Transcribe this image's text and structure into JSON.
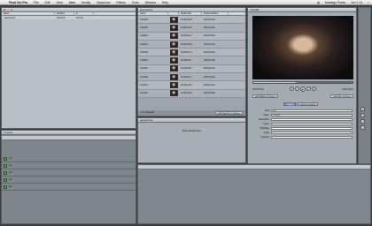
{
  "menubar": {
    "app": "Final Cut Pro",
    "items": [
      "File",
      "Edit",
      "View",
      "Mark",
      "Modify",
      "Sequence",
      "Effects",
      "Tools",
      "Window",
      "Help"
    ],
    "user": "Santiago Prada",
    "clock": "Jun 2 12"
  },
  "browser": {
    "title": "Browser",
    "headers": [
      "Name",
      "Duration",
      "In"
    ],
    "items": [
      {
        "name": "appleshrine",
        "duration": "00:00:12",
        "in": "Not Set"
      }
    ]
  },
  "bin": {
    "title": "appleshrine",
    "headers": [
      "Name",
      "Media Start",
      "Media Duration"
    ],
    "rows": [
      {
        "name": "CO0028",
        "start": "01:08:36:08",
        "dur": "00:00:04:12"
      },
      {
        "name": "CO0030",
        "start": "01:08:40:20",
        "dur": "00:00:03:21"
      },
      {
        "name": "CO0036",
        "start": "01:08:44:17",
        "dur": "00:00:05:02"
      },
      {
        "name": "CO0042",
        "start": "01:08:49:19",
        "dur": "00:00:02:18"
      },
      {
        "name": "CO0048",
        "start": "01:08:52:13",
        "dur": "00:00:06:04"
      },
      {
        "name": "CO0054",
        "start": "01:08:58:17",
        "dur": "00:00:04:09"
      },
      {
        "name": "CO1091",
        "start": "01:09:03:02",
        "dur": "00:00:03:15"
      },
      {
        "name": "CO1096",
        "start": "01:09:06:17",
        "dur": "00:00:05:22"
      },
      {
        "name": "CO1103",
        "start": "01:09:12:15",
        "dur": "00:00:04:01"
      },
      {
        "name": "CO1109",
        "start": "01:09:16:16",
        "dur": "00:00:03:08"
      }
    ],
    "status": "1 of 1 selected",
    "add_button": "Add Selection to Queue"
  },
  "queue": {
    "title": "appleshrine",
    "drop_label": "Drop Media Here"
  },
  "viewer": {
    "title": "CO1109",
    "timecode_left": "00:00:00:00",
    "timecode_right": "00:00:05:22",
    "button_left": "Add Marker to Queue",
    "button_right": "Add Clip to Queue",
    "tabs": [
      "Logging",
      "Capture Settings"
    ],
    "fields": [
      {
        "label": "Reel",
        "value": "001"
      },
      {
        "label": "Name",
        "value": "CO1109"
      },
      {
        "label": "Description",
        "value": ""
      },
      {
        "label": "Scene",
        "value": ""
      },
      {
        "label": "Shot/Take",
        "value": ""
      },
      {
        "label": "Angle",
        "value": ""
      },
      {
        "label": "Log Note",
        "value": ""
      }
    ]
  },
  "timeline": {
    "title": "Timeline",
    "tracks": [
      "V1",
      "A1",
      "A2",
      "A3",
      "A4"
    ]
  },
  "colors": {
    "accent": "#3b6fd1",
    "panel": "#a7adb6"
  }
}
